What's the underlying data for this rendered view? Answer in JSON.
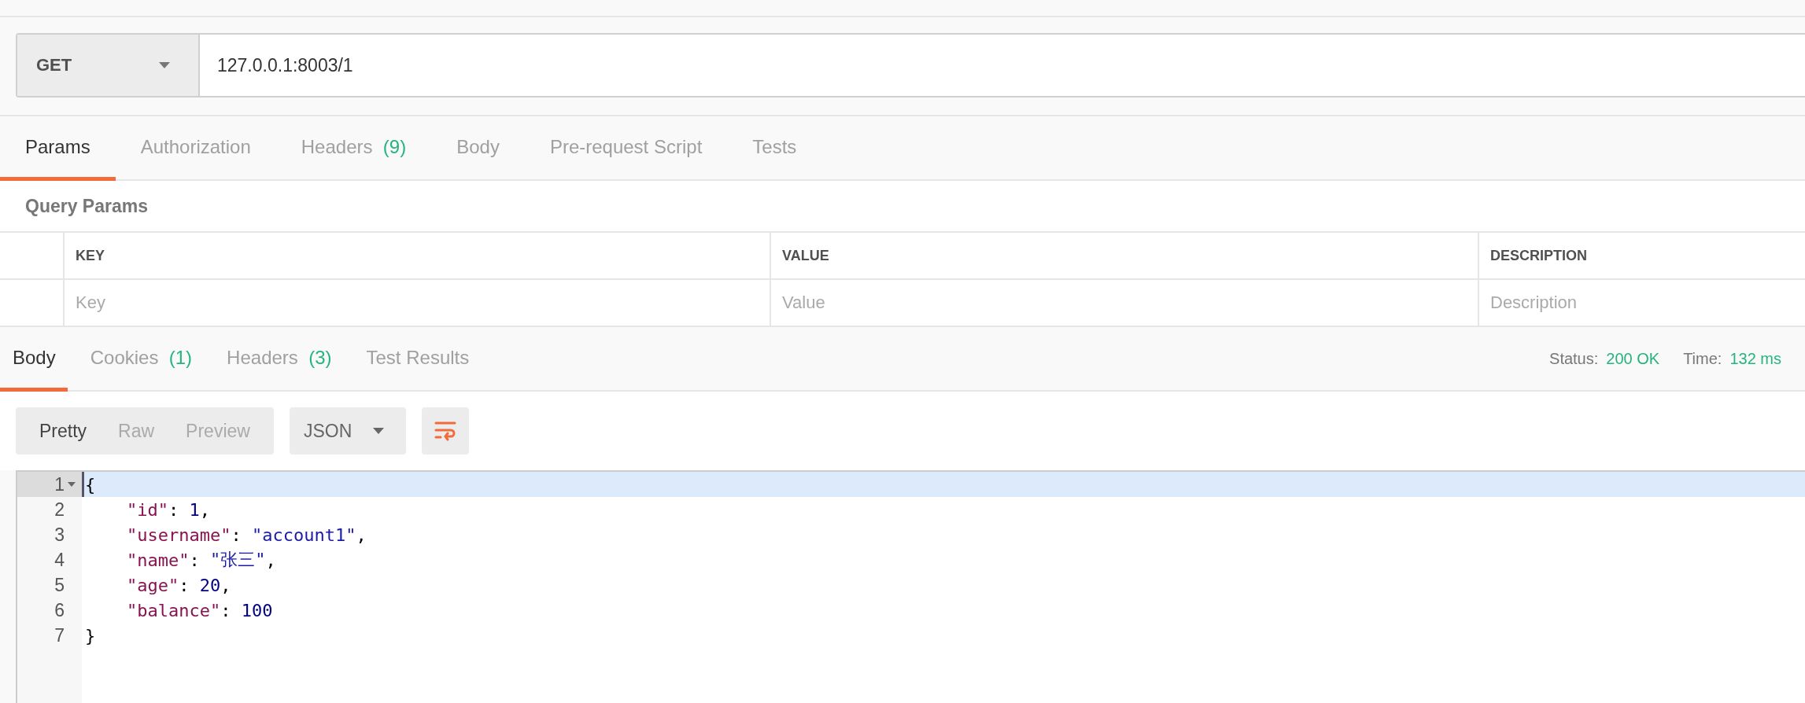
{
  "request": {
    "method": "GET",
    "url": "127.0.0.1:8003/1"
  },
  "request_tabs": [
    {
      "label": "Params",
      "selected": true
    },
    {
      "label": "Authorization",
      "selected": false
    },
    {
      "label": "Headers",
      "count": "(9)",
      "selected": false
    },
    {
      "label": "Body",
      "selected": false
    },
    {
      "label": "Pre-request Script",
      "selected": false
    },
    {
      "label": "Tests",
      "selected": false
    }
  ],
  "query_params": {
    "title": "Query Params",
    "columns": [
      "KEY",
      "VALUE",
      "DESCRIPTION"
    ],
    "placeholders": [
      "Key",
      "Value",
      "Description"
    ]
  },
  "response_tabs": [
    {
      "label": "Body",
      "selected": true
    },
    {
      "label": "Cookies",
      "count": "(1)",
      "selected": false
    },
    {
      "label": "Headers",
      "count": "(3)",
      "selected": false
    },
    {
      "label": "Test Results",
      "selected": false
    }
  ],
  "status": {
    "label": "Status:",
    "value": "200 OK"
  },
  "time": {
    "label": "Time:",
    "value": "132 ms"
  },
  "view_modes": [
    {
      "label": "Pretty",
      "selected": true
    },
    {
      "label": "Raw",
      "selected": false
    },
    {
      "label": "Preview",
      "selected": false
    }
  ],
  "format": "JSON",
  "code": [
    {
      "number": "1",
      "active": true,
      "foldable": true,
      "tokens": [
        {
          "kind": "punct",
          "text": "{"
        }
      ]
    },
    {
      "number": "2",
      "active": false,
      "foldable": false,
      "tokens": [
        {
          "kind": "key",
          "text": "    \"id\""
        },
        {
          "kind": "punct",
          "text": ": "
        },
        {
          "kind": "number",
          "text": "1"
        },
        {
          "kind": "punct",
          "text": ","
        }
      ]
    },
    {
      "number": "3",
      "active": false,
      "foldable": false,
      "tokens": [
        {
          "kind": "key",
          "text": "    \"username\""
        },
        {
          "kind": "punct",
          "text": ": "
        },
        {
          "kind": "string",
          "text": "\"account1\""
        },
        {
          "kind": "punct",
          "text": ","
        }
      ]
    },
    {
      "number": "4",
      "active": false,
      "foldable": false,
      "tokens": [
        {
          "kind": "key",
          "text": "    \"name\""
        },
        {
          "kind": "punct",
          "text": ": "
        },
        {
          "kind": "string",
          "text": "\"张三\""
        },
        {
          "kind": "punct",
          "text": ","
        }
      ]
    },
    {
      "number": "5",
      "active": false,
      "foldable": false,
      "tokens": [
        {
          "kind": "key",
          "text": "    \"age\""
        },
        {
          "kind": "punct",
          "text": ": "
        },
        {
          "kind": "number",
          "text": "20"
        },
        {
          "kind": "punct",
          "text": ","
        }
      ]
    },
    {
      "number": "6",
      "active": false,
      "foldable": false,
      "tokens": [
        {
          "kind": "key",
          "text": "    \"balance\""
        },
        {
          "kind": "punct",
          "text": ": "
        },
        {
          "kind": "number",
          "text": "100"
        }
      ]
    },
    {
      "number": "7",
      "active": false,
      "foldable": false,
      "tokens": [
        {
          "kind": "punct",
          "text": "}"
        }
      ]
    }
  ]
}
